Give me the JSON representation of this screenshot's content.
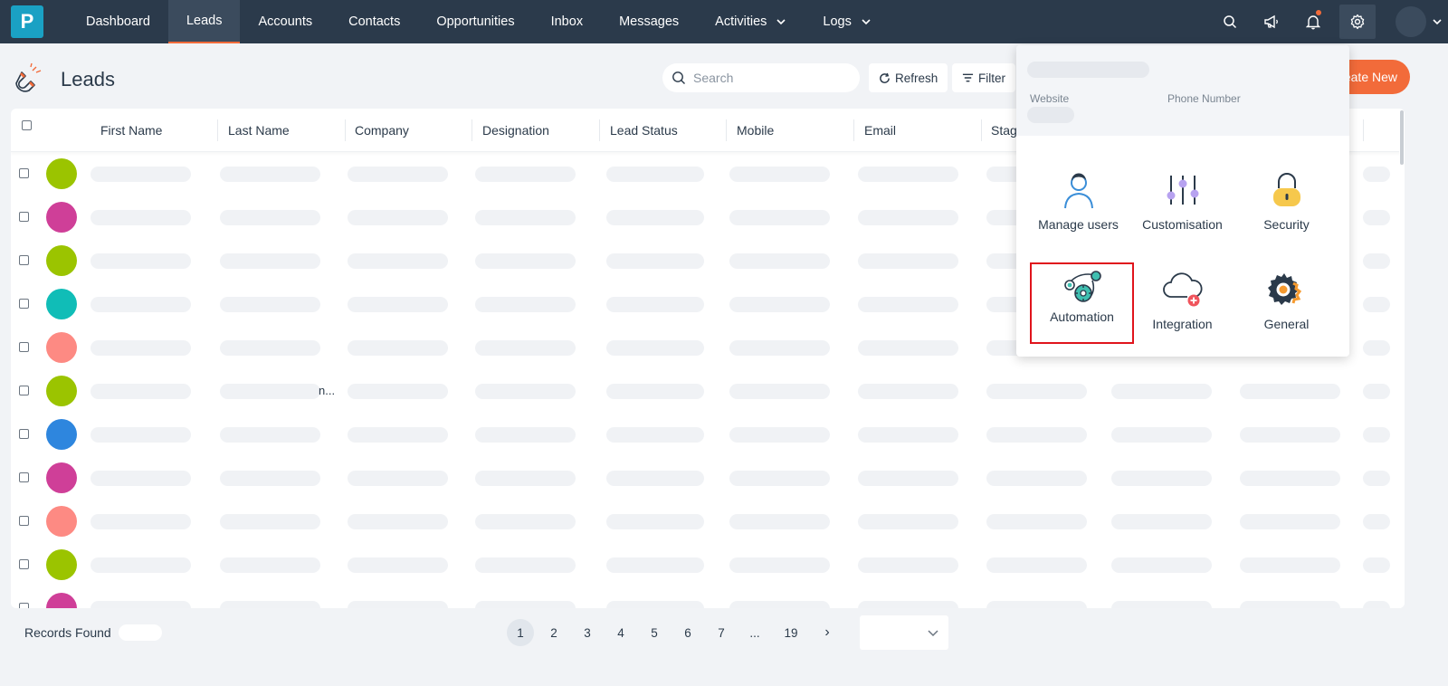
{
  "nav": {
    "logo_letter": "P",
    "items": [
      {
        "label": "Dashboard",
        "active": false,
        "dropdown": false
      },
      {
        "label": "Leads",
        "active": true,
        "dropdown": false
      },
      {
        "label": "Accounts",
        "active": false,
        "dropdown": false
      },
      {
        "label": "Contacts",
        "active": false,
        "dropdown": false
      },
      {
        "label": "Opportunities",
        "active": false,
        "dropdown": false
      },
      {
        "label": "Inbox",
        "active": false,
        "dropdown": false
      },
      {
        "label": "Messages",
        "active": false,
        "dropdown": false
      },
      {
        "label": "Activities",
        "active": false,
        "dropdown": true
      },
      {
        "label": "Logs",
        "active": false,
        "dropdown": true
      }
    ],
    "right_icons": [
      "search-icon",
      "megaphone-icon",
      "bell-icon",
      "gear-icon"
    ]
  },
  "page": {
    "title": "Leads",
    "search_placeholder": "Search",
    "refresh_label": "Refresh",
    "filter_label": "Filter",
    "create_label": "Create New"
  },
  "table": {
    "columns": [
      "First Name",
      "Last Name",
      "Company",
      "Designation",
      "Lead Status",
      "Mobile",
      "Email",
      "Stage"
    ],
    "avatar_colors": [
      "#9bc400",
      "#cf3f98",
      "#9bc400",
      "#10bdb7",
      "#fd8a83",
      "#9bc400",
      "#2e86de",
      "#cf3f98",
      "#fd8a83",
      "#9bc400",
      "#cf3f98"
    ],
    "truncated_cell": "n..."
  },
  "footer": {
    "records_label": "Records Found",
    "pages": [
      "1",
      "2",
      "3",
      "4",
      "5",
      "6",
      "7",
      "...",
      "19"
    ],
    "active_page": "1",
    "next_symbol": "›"
  },
  "settings_menu": {
    "website_label": "Website",
    "phone_label": "Phone Number",
    "items": [
      {
        "label": "Manage users",
        "icon": "user-icon"
      },
      {
        "label": "Customisation",
        "icon": "sliders-icon"
      },
      {
        "label": "Security",
        "icon": "lock-icon"
      },
      {
        "label": "Automation",
        "icon": "automation-icon",
        "highlighted": true
      },
      {
        "label": "Integration",
        "icon": "cloud-plus-icon"
      },
      {
        "label": "General",
        "icon": "gears-icon"
      }
    ],
    "highlight_color": "#e0141c"
  },
  "colors": {
    "nav_bg": "#2b3a4b",
    "accent": "#f26b3a",
    "logo": "#1aa1c4"
  }
}
